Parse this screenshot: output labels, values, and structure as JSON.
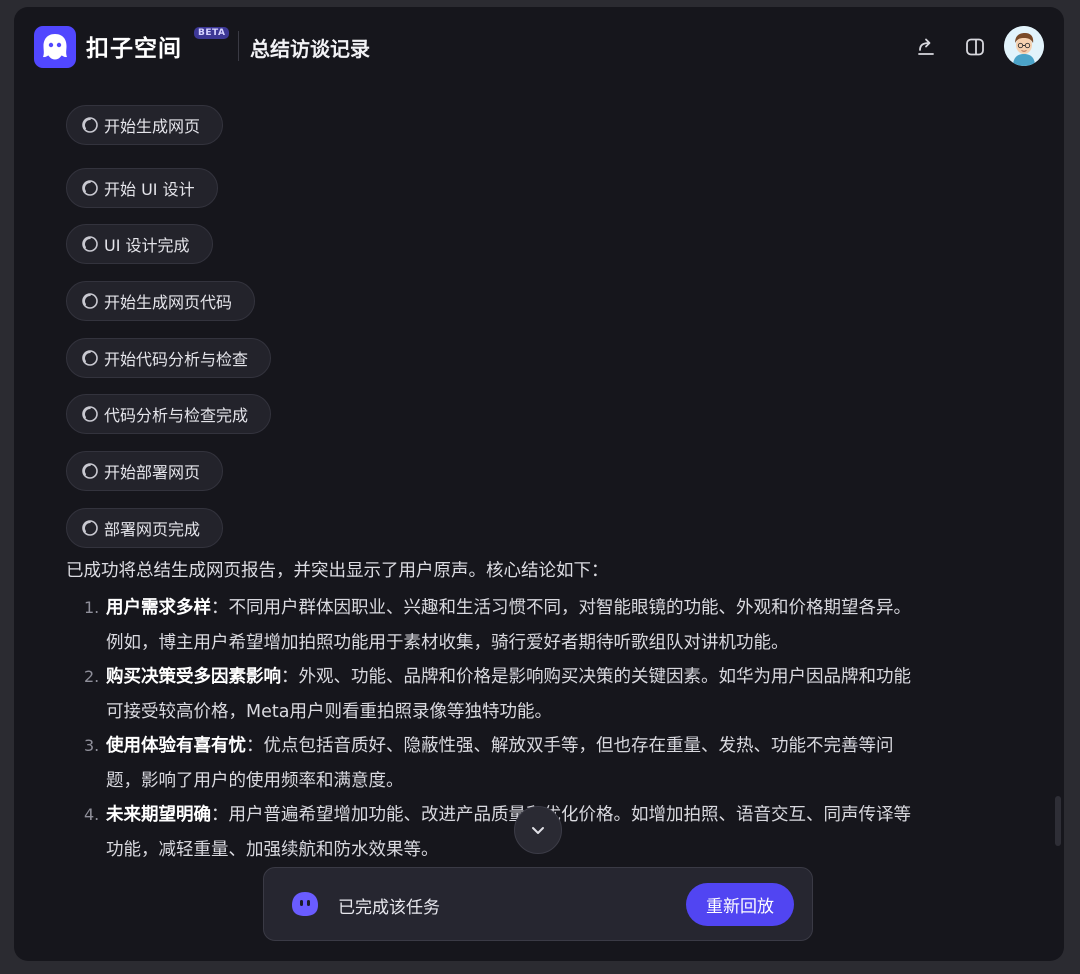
{
  "header": {
    "brand": "扣子空间",
    "beta": "BETA",
    "title": "总结访谈记录"
  },
  "steps": [
    "开始生成网页",
    "开始 UI 设计",
    "UI 设计完成",
    "开始生成网页代码",
    "开始代码分析与检查",
    "代码分析与检查完成",
    "开始部署网页",
    "部署网页完成"
  ],
  "summary": {
    "intro": "已成功将总结生成网页报告，并突出显示了用户原声。核心结论如下：",
    "points": [
      {
        "num": "1.",
        "title": "用户需求多样",
        "sep": "：",
        "line1": "不同用户群体因职业、兴趣和生活习惯不同，对智能眼镜的功能、外观和价格期望各异。",
        "line2": "例如，博主用户希望增加拍照功能用于素材收集，骑行爱好者期待听歌组队对讲机功能。"
      },
      {
        "num": "2.",
        "title": "购买决策受多因素影响",
        "sep": "：",
        "line1": "外观、功能、品牌和价格是影响购买决策的关键因素。如华为用户因品牌和功能",
        "line2": "可接受较高价格，Meta用户则看重拍照录像等独特功能。"
      },
      {
        "num": "3.",
        "title": "使用体验有喜有忧",
        "sep": "：",
        "line1": "优点包括音质好、隐蔽性强、解放双手等，但也存在重量、发热、功能不完善等问",
        "line2": "题，影响了用户的使用频率和满意度。"
      },
      {
        "num": "4.",
        "title": "未来期望明确",
        "sep": "：",
        "line1": "用户普遍希望增加功能、改进产品质量和优化价格。如增加拍照、语音交互、同声传译等",
        "line2": "功能，减轻重量、加强续航和防水效果等。"
      }
    ]
  },
  "taskbar": {
    "status": "已完成该任务",
    "replay_label": "重新回放"
  },
  "colors": {
    "accent": "#5145f2",
    "background": "#16161c",
    "pill": "#23232b"
  },
  "icons": [
    "share-icon",
    "sidebar-toggle-icon",
    "spinner-icon",
    "chevron-down-icon",
    "bot-icon"
  ]
}
